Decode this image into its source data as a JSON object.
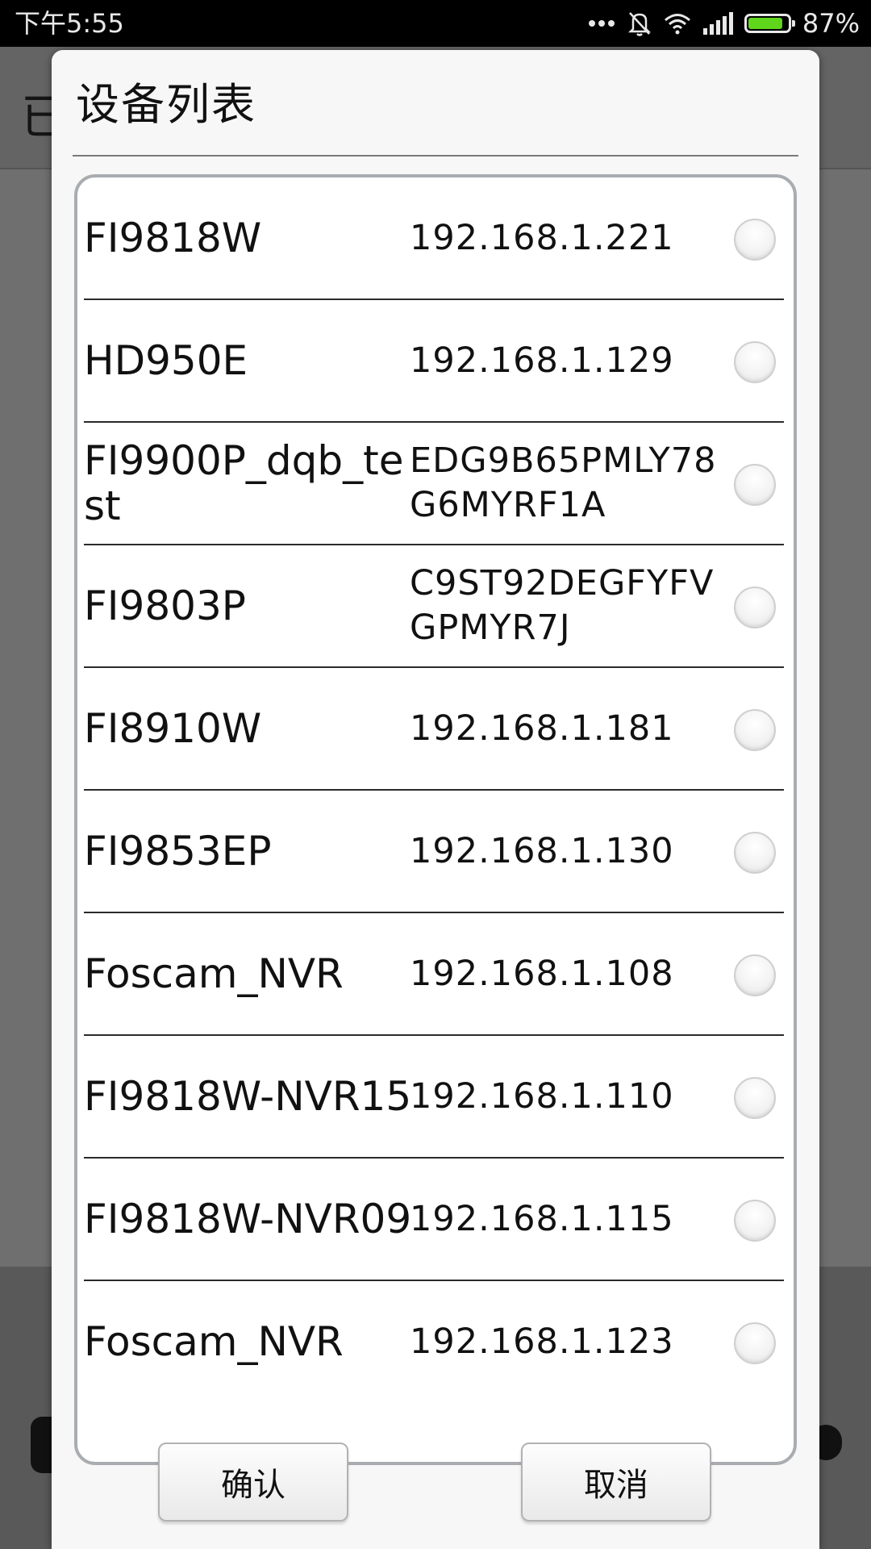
{
  "status_bar": {
    "time": "下午5:55",
    "battery": "87%",
    "battery_level": 0.87,
    "icons": [
      "more-dots-icon",
      "silent-bell-icon",
      "wifi-icon",
      "signal-icon",
      "battery-icon"
    ],
    "battery_color": "#5fd61c"
  },
  "background": {
    "title_fragment": "已"
  },
  "dialog": {
    "title": "设备列表",
    "devices": [
      {
        "name": "FI9818W",
        "address": "192.168.1.221",
        "selected": false
      },
      {
        "name": "HD950E",
        "address": "192.168.1.129",
        "selected": false
      },
      {
        "name": "FI9900P_dqb_te\nst",
        "address": "EDG9B65PMLY78\nG6MYRF1A",
        "selected": false
      },
      {
        "name": "FI9803P",
        "address": "C9ST92DEGFYFV\nGPMYR7J",
        "selected": false
      },
      {
        "name": "FI8910W",
        "address": "192.168.1.181",
        "selected": false
      },
      {
        "name": "FI9853EP",
        "address": "192.168.1.130",
        "selected": false
      },
      {
        "name": "Foscam_NVR",
        "address": "192.168.1.108",
        "selected": false
      },
      {
        "name": "FI9818W-NVR15",
        "address": "192.168.1.110",
        "selected": false
      },
      {
        "name": "FI9818W-NVR09",
        "address": "192.168.1.115",
        "selected": false
      },
      {
        "name": "Foscam_NVR",
        "address": "192.168.1.123",
        "selected": false
      }
    ],
    "confirm_label": "确认",
    "cancel_label": "取消"
  }
}
